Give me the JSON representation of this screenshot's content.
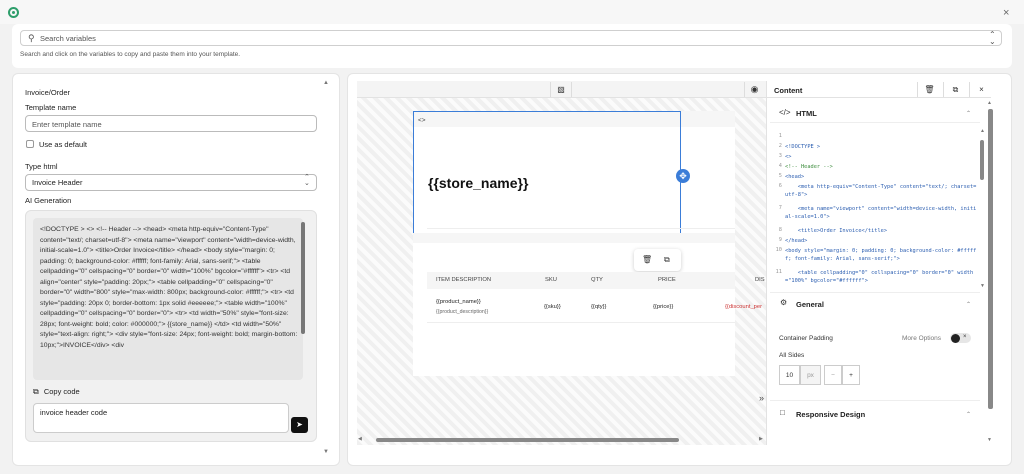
{
  "topbar": {
    "logo_icon": "logo-icon",
    "close_icon": "close-icon",
    "close_glyph": "×"
  },
  "search": {
    "placeholder": "Search variables",
    "help_text": "Search and click on the variables to copy and paste them into your template.",
    "arrow_up": "⌃",
    "arrow_down": "⌄"
  },
  "left": {
    "section_title": "Invoice/Order",
    "template_name_label": "Template name",
    "template_name_placeholder": "Enter template name",
    "use_default_label": "Use as default",
    "type_html_label": "Type html",
    "type_html_value": "Invoice Header",
    "ai_generation_label": "AI Generation",
    "generated_code": "<!DOCTYPE > <> <!-- Header --> <head> <meta http-equiv=\"Content-Type\" content=\"text/; charset=utf-8\"> <meta name=\"viewport\" content=\"width=device-width, initial-scale=1.0\"> <title>Order Invoice</title> </head> <body style=\"margin: 0; padding: 0; background-color: #ffffff; font-family: Arial, sans-serif;\"> <table cellpadding=\"0\" cellspacing=\"0\" border=\"0\" width=\"100%\" bgcolor=\"#ffffff\"> <tr> <td align=\"center\" style=\"padding: 20px;\"> <table cellpadding=\"0\" cellspacing=\"0\" border=\"0\" width=\"800\" style=\"max-width: 800px; background-color: #ffffff;\"> <tr> <td style=\"padding: 20px 0; border-bottom: 1px solid #eeeeee;\"> <table width=\"100%\" cellpadding=\"0\" cellspacing=\"0\" border=\"0\"> <tr> <td width=\"50%\" style=\"font-size: 28px; font-weight: bold; color: #000000;\"> {{store_name}} </td> <td width=\"50%\" style=\"text-align: right;\"> <div style=\"font-size: 24px; font-weight: bold; margin-bottom: 10px;\">INVOICE</div> <div",
    "copy_code_label": "Copy code",
    "prompt_value": "invoice header code",
    "send_icon": "send-icon"
  },
  "canvas": {
    "device_icon": "desktop-icon",
    "preview_icon": "eye-icon",
    "tag_label": "<>",
    "store_name": "{{store_name}}",
    "table_headers": [
      "ITEM DESCRIPTION",
      "SKU",
      "QTY",
      "PRICE",
      "DIS"
    ],
    "row": {
      "product_name": "{{product_name}}",
      "product_description": "{{product_description}}",
      "sku": "{{sku}}",
      "qty": "{{qty}}",
      "price": "{{price}}",
      "discount": "{{discount_per"
    },
    "expand_glyph": "»"
  },
  "props": {
    "title": "Content",
    "html_section": "HTML",
    "code_lines": [
      {
        "n": "1",
        "t": ""
      },
      {
        "n": "2",
        "t": "<!DOCTYPE >"
      },
      {
        "n": "3",
        "t": "<>"
      },
      {
        "n": "4",
        "t": "<!-- Header -->"
      },
      {
        "n": "5",
        "t": "<head>"
      },
      {
        "n": "6",
        "t": "    <meta http-equiv=\"Content-Type\" content=\"text/; charset=utf-8\">"
      },
      {
        "n": "7",
        "t": "    <meta name=\"viewport\" content=\"width=device-width, initial-scale=1.0\">"
      },
      {
        "n": "8",
        "t": "    <title>Order Invoice</title>"
      },
      {
        "n": "9",
        "t": "</head>"
      },
      {
        "n": "10",
        "t": "<body style=\"margin: 0; padding: 0; background-color: #ffffff; font-family: Arial, sans-serif;\">"
      },
      {
        "n": "11",
        "t": "    <table cellpadding=\"0\" cellspacing=\"0\" border=\"0\" width=\"100%\" bgcolor=\"#ffffff\">"
      }
    ],
    "general_section": "General",
    "container_padding_label": "Container Padding",
    "more_options_label": "More Options",
    "all_sides_label": "All Sides",
    "padding_value": "10",
    "padding_unit": "px",
    "minus": "−",
    "plus": "+",
    "responsive_section": "Responsive Design"
  },
  "colors": {
    "accent": "#3b7dd8",
    "brand": "#2e9e6b",
    "discount": "#cc3333"
  }
}
